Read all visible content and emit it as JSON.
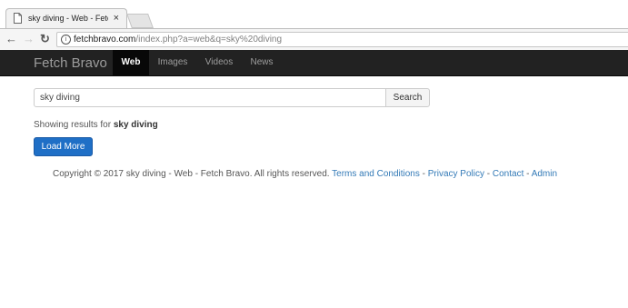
{
  "browser": {
    "tab_title": "sky diving - Web - Fetch",
    "tab_close": "×",
    "url_host": "fetchbravo.com",
    "url_path": "/index.php?a=web&q=sky%20diving"
  },
  "navbar": {
    "brand": "Fetch Bravo",
    "items": [
      {
        "label": "Web",
        "active": true
      },
      {
        "label": "Images",
        "active": false
      },
      {
        "label": "Videos",
        "active": false
      },
      {
        "label": "News",
        "active": false
      }
    ]
  },
  "search": {
    "value": "sky diving",
    "button_label": "Search"
  },
  "results": {
    "showing_prefix": "Showing results for ",
    "query": "sky diving",
    "load_more_label": "Load More"
  },
  "footer": {
    "copyright": "Copyright © 2017 sky diving - Web - Fetch Bravo. All rights reserved. ",
    "links": [
      "Terms and Conditions",
      "Privacy Policy",
      "Contact",
      "Admin"
    ],
    "separator": " - "
  },
  "colors": {
    "navbar_bg": "#222222",
    "primary_button": "#1f6fc6",
    "link": "#337ab7"
  }
}
